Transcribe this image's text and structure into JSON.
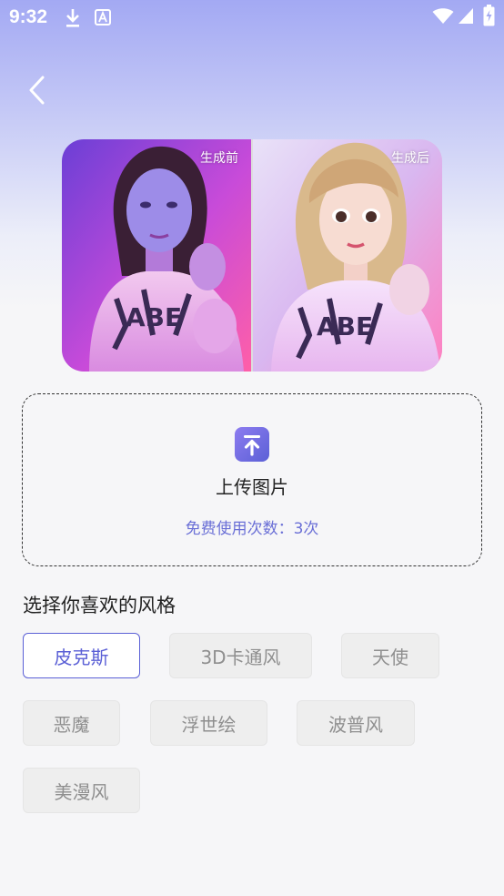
{
  "status_bar": {
    "time": "9:32",
    "icons": [
      "download-icon",
      "font-app-icon",
      "wifi-icon",
      "signal-icon",
      "battery-charging-icon"
    ]
  },
  "nav": {
    "back_icon": "chevron-left-icon"
  },
  "compare": {
    "before_label": "生成前",
    "after_label": "生成后"
  },
  "upload": {
    "icon": "upload-icon",
    "title": "上传图片",
    "hint": "免费使用次数：3次"
  },
  "styles": {
    "title": "选择你喜欢的风格",
    "selected_index": 0,
    "items": [
      {
        "label": "皮克斯"
      },
      {
        "label": "3D卡通风"
      },
      {
        "label": "天使"
      },
      {
        "label": "恶魔"
      },
      {
        "label": "浮世绘"
      },
      {
        "label": "波普风"
      },
      {
        "label": "美漫风"
      }
    ]
  },
  "colors": {
    "accent": "#5b60d6",
    "header_gradient_top": "#a3a9f3",
    "background": "#f6f6f8",
    "chip_bg": "#eeeeee",
    "chip_text": "#8f8f8f"
  }
}
